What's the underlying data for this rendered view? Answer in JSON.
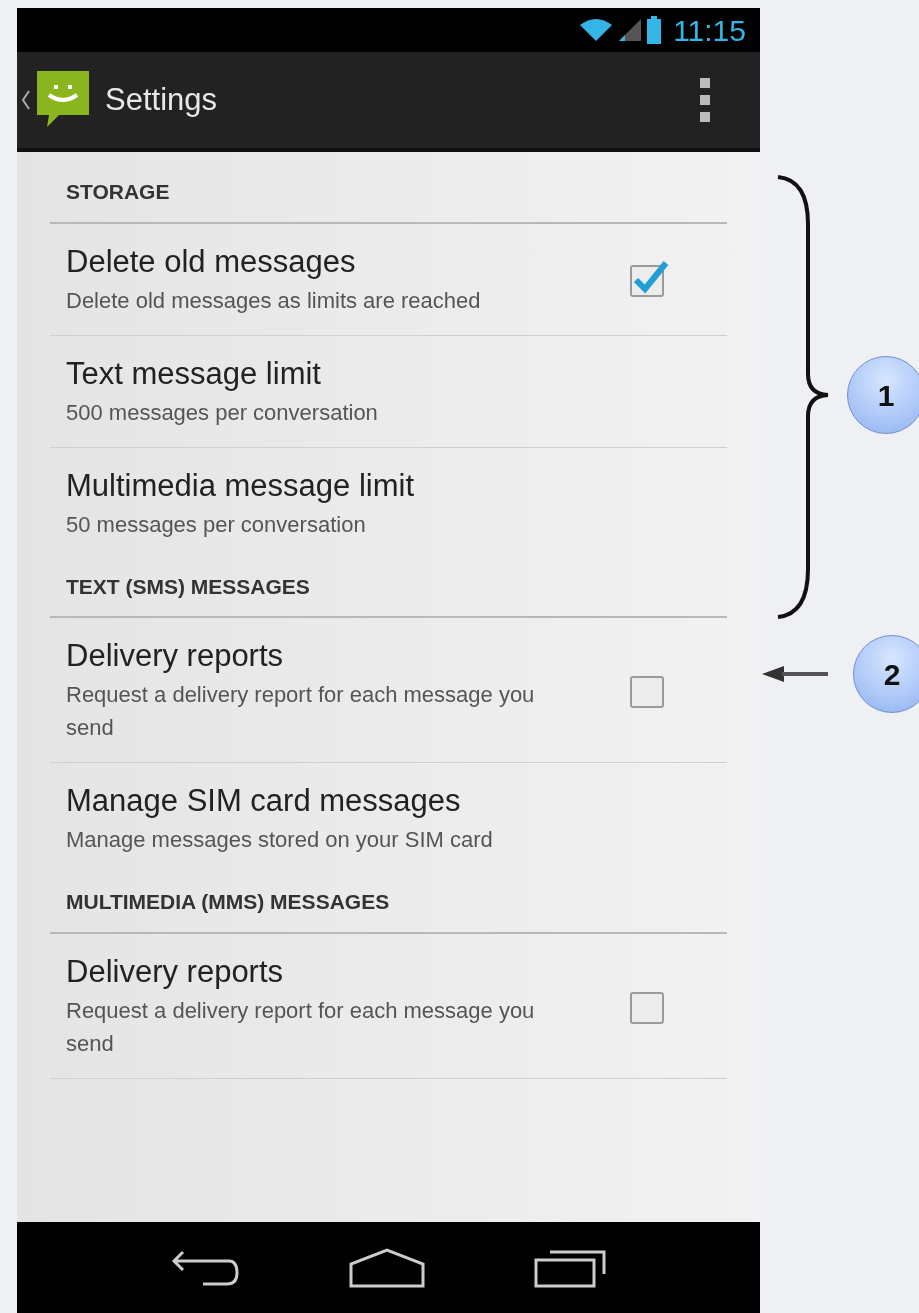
{
  "status_bar": {
    "time": "11:15"
  },
  "action_bar": {
    "title": "Settings"
  },
  "sections": [
    {
      "header": "STORAGE",
      "items": [
        {
          "kind": "checkbox",
          "title": "Delete old messages",
          "subtitle": "Delete old messages as limits are reached",
          "checked": true
        },
        {
          "kind": "plain",
          "title": "Text message limit",
          "subtitle": "500 messages per conversation"
        },
        {
          "kind": "plain",
          "title": "Multimedia message limit",
          "subtitle": "50 messages per conversation"
        }
      ]
    },
    {
      "header": "TEXT (SMS) MESSAGES",
      "items": [
        {
          "kind": "checkbox",
          "title": "Delivery reports",
          "subtitle": "Request a delivery report for each message you send",
          "checked": false
        },
        {
          "kind": "plain",
          "title": "Manage SIM card messages",
          "subtitle": "Manage messages stored on your SIM card"
        }
      ]
    },
    {
      "header": "MULTIMEDIA (MMS) MESSAGES",
      "items": [
        {
          "kind": "checkbox",
          "title": "Delivery reports",
          "subtitle": "Request a delivery report for each message you send",
          "checked": false
        }
      ]
    }
  ],
  "callouts": [
    {
      "kind": "brace",
      "label": "1"
    },
    {
      "kind": "arrow",
      "label": "2"
    }
  ]
}
